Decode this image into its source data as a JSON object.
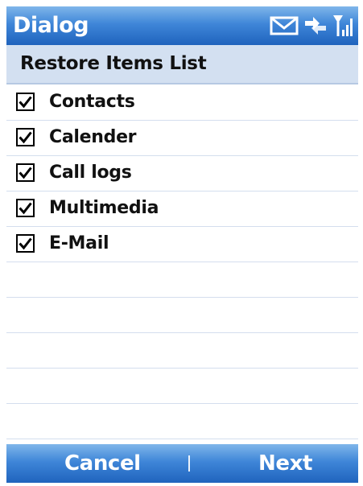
{
  "title_bar": {
    "title": "Dialog",
    "icons": [
      "mail-icon",
      "connection-icon",
      "signal-icon"
    ]
  },
  "list": {
    "header": "Restore Items List",
    "items": [
      {
        "label": "Contacts",
        "checked": true
      },
      {
        "label": "Calender",
        "checked": true
      },
      {
        "label": "Call logs",
        "checked": true
      },
      {
        "label": "Multimedia",
        "checked": true
      },
      {
        "label": "E-Mail",
        "checked": true
      }
    ]
  },
  "softkeys": {
    "left": "Cancel",
    "right": "Next"
  },
  "colors": {
    "title_bar": "#3f86d8",
    "header_band": "#d3e0f1",
    "divider": "#d4deee"
  }
}
